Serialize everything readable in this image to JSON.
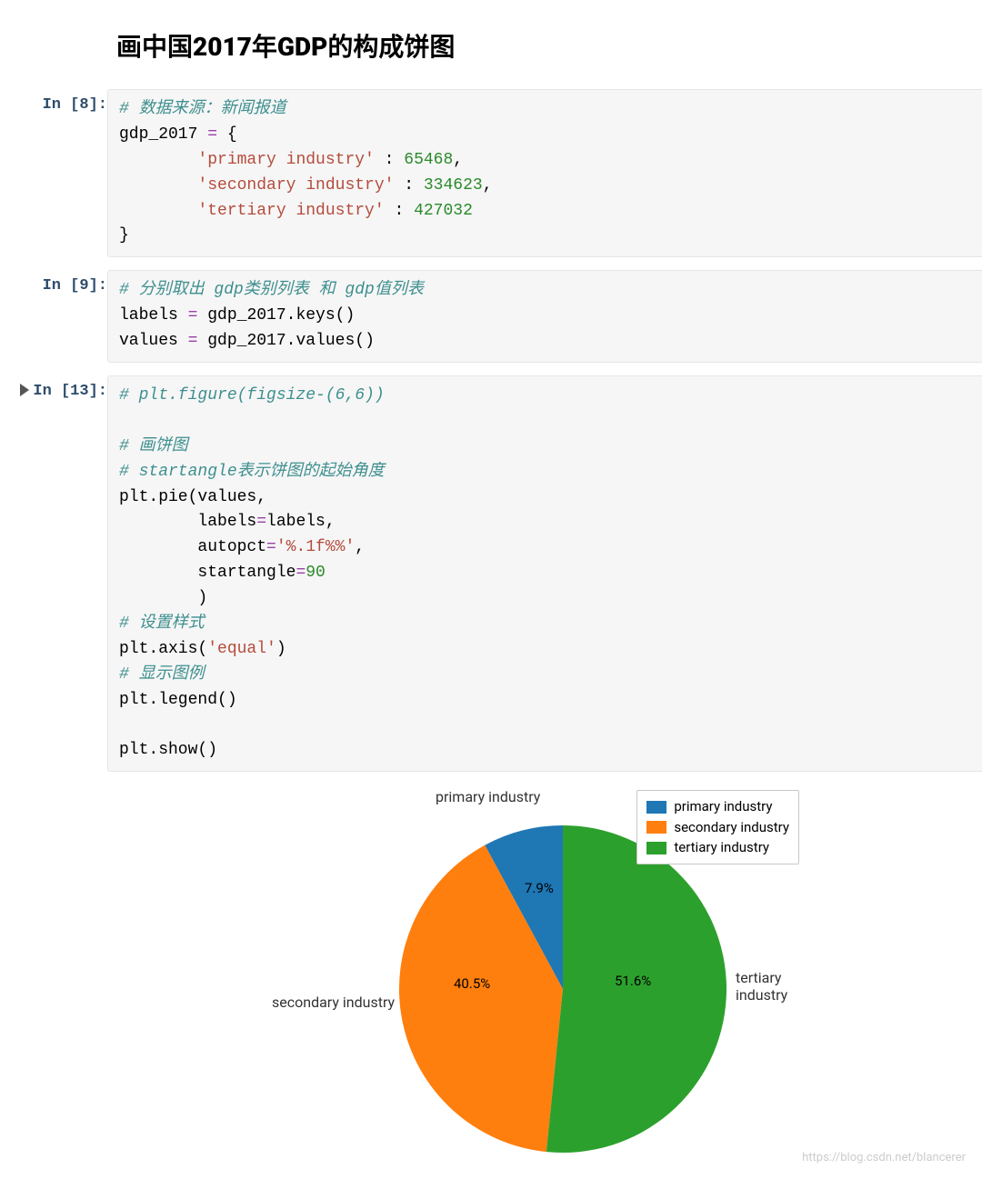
{
  "title": "画中国2017年GDP的构成饼图",
  "prompts": {
    "p1": "In [8]:",
    "p2": "In [9]:",
    "p3": "In [13]:"
  },
  "code1": {
    "l1_comment": "# 数据来源：新闻报道",
    "l2_a": "gdp_2017 ",
    "l2_op": "=",
    "l2_b": " {",
    "l3_a": "        ",
    "l3_str": "'primary industry'",
    "l3_b": " : ",
    "l3_num": "65468",
    "l3_c": ",",
    "l4_a": "        ",
    "l4_str": "'secondary industry'",
    "l4_b": " : ",
    "l4_num": "334623",
    "l4_c": ",",
    "l5_a": "        ",
    "l5_str": "'tertiary industry'",
    "l5_b": " : ",
    "l5_num": "427032",
    "l6": "}"
  },
  "code2": {
    "l1_comment": "# 分别取出 gdp类别列表 和 gdp值列表",
    "l2_a": "labels ",
    "l2_op": "=",
    "l2_b": " gdp_2017.keys()",
    "l3_a": "values ",
    "l3_op": "=",
    "l3_b": " gdp_2017.values()"
  },
  "code3": {
    "l1_comment": "# plt.figure(figsize-(6,6))",
    "l3_comment": "# 画饼图",
    "l4_comment": "# startangle表示饼图的起始角度",
    "l5": "plt.pie(values,",
    "l6_a": "        labels",
    "l6_op": "=",
    "l6_b": "labels,",
    "l7_a": "        autopct",
    "l7_op": "=",
    "l7_str": "'%.1f%%'",
    "l7_b": ",",
    "l8_a": "        startangle",
    "l8_op": "=",
    "l8_num": "90",
    "l9": "        )",
    "l10_comment": "# 设置样式",
    "l11_a": "plt.axis(",
    "l11_str": "'equal'",
    "l11_b": ")",
    "l12_comment": "# 显示图例",
    "l13": "plt.legend()",
    "l15": "plt.show()"
  },
  "chart_data": {
    "type": "pie",
    "categories": [
      "primary industry",
      "secondary industry",
      "tertiary industry"
    ],
    "values": [
      65468,
      334623,
      427032
    ],
    "pct": [
      "7.9%",
      "40.5%",
      "51.6%"
    ],
    "colors": [
      "#1f77b4",
      "#ff7f0e",
      "#2ca02c"
    ],
    "startangle": 90,
    "legend_pos": "upper right"
  },
  "pct": {
    "p1": "7.9%",
    "p2": "40.5%",
    "p3": "51.6%"
  },
  "lbl": {
    "l1": "primary industry",
    "l2": "secondary industry",
    "l3": "tertiary industry"
  },
  "legend": {
    "e1": "primary industry",
    "e2": "secondary industry",
    "e3": "tertiary industry"
  },
  "watermark": "https://blog.csdn.net/blancerer"
}
